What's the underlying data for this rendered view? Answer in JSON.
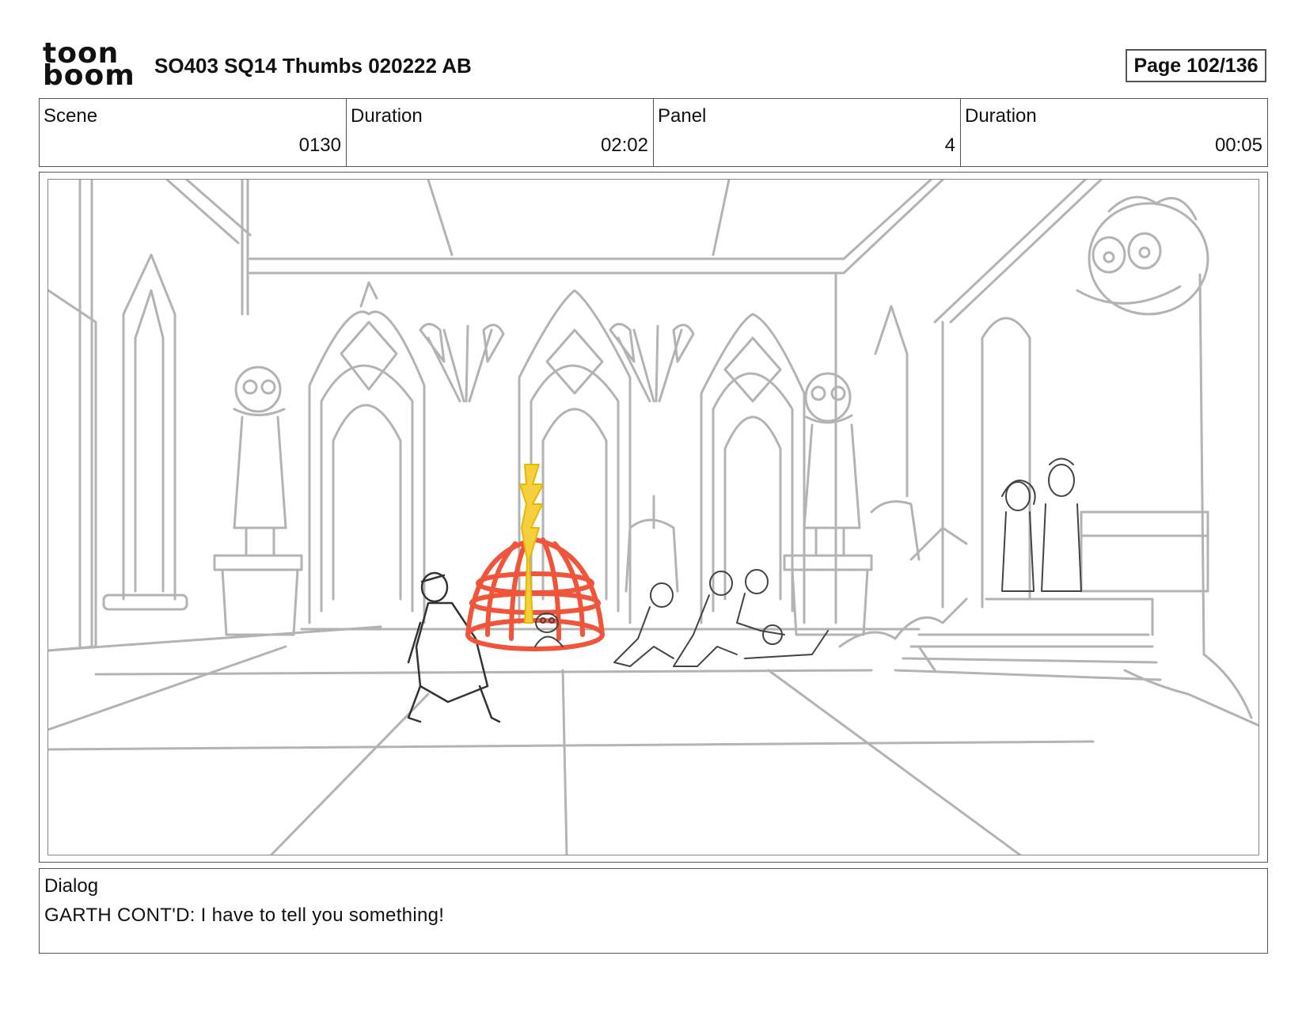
{
  "header": {
    "logo_line1": "toon",
    "logo_line2": "boom",
    "title": "SO403 SQ14 Thumbs 020222 AB",
    "page": "Page 102/136"
  },
  "info": {
    "scene_label": "Scene",
    "scene_value": "0130",
    "scene_duration_label": "Duration",
    "scene_duration_value": "02:02",
    "panel_label": "Panel",
    "panel_value": "4",
    "panel_duration_label": "Duration",
    "panel_duration_value": "00:05"
  },
  "dialog": {
    "label": "Dialog",
    "text": "GARTH CONT'D: I have to tell you something!"
  },
  "colors": {
    "sketch": "#b3b3b3",
    "cage": "#f0553b",
    "beam": "#f4d03f"
  }
}
